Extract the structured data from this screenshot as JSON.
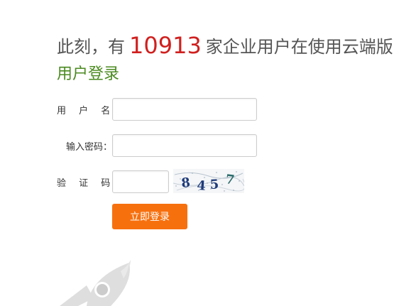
{
  "headline": {
    "prefix": "此刻，有",
    "count": "10913",
    "suffix": "家企业用户在使用云端版"
  },
  "login_title": "用户登录",
  "form": {
    "username_label": "用 户 名：",
    "password_label": "输入密码：",
    "captcha_label": "验 证 码：",
    "username_value": "",
    "password_value": "",
    "captcha_value": "",
    "captcha_image_text": "8457"
  },
  "submit_label": "立即登录",
  "colors": {
    "accent": "#f7700e",
    "count": "#d0201f",
    "title": "#4a8a1f"
  },
  "icons": {
    "decoration": "rocket-icon"
  }
}
